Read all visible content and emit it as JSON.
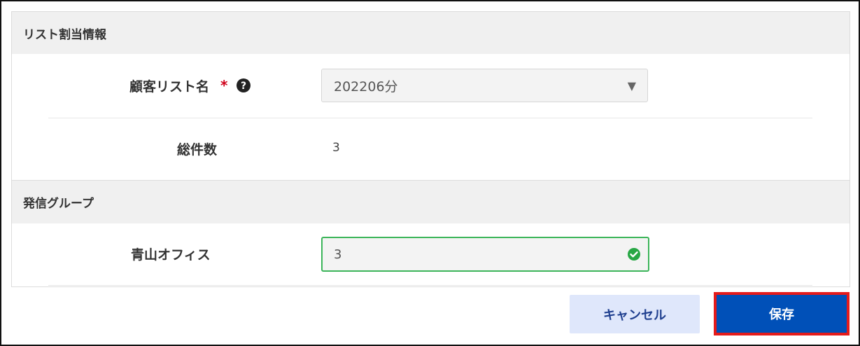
{
  "section_list": {
    "title": "リスト割当情報",
    "customer_list": {
      "label": "顧客リスト名",
      "required_mark": "*",
      "selected_value": "202206分"
    },
    "total_count": {
      "label": "総件数",
      "value": "3"
    }
  },
  "section_group": {
    "title": "発信グループ",
    "office": {
      "label": "青山オフィス",
      "value": "3"
    }
  },
  "buttons": {
    "cancel": "キャンセル",
    "save": "保存"
  },
  "colors": {
    "primary": "#0050b8",
    "highlight": "#e41b1b",
    "valid": "#3cb55a",
    "required": "#d0021b"
  },
  "icons": {
    "help": "question-circle-icon",
    "caret": "triangle-down-icon",
    "valid": "check-circle-icon"
  }
}
